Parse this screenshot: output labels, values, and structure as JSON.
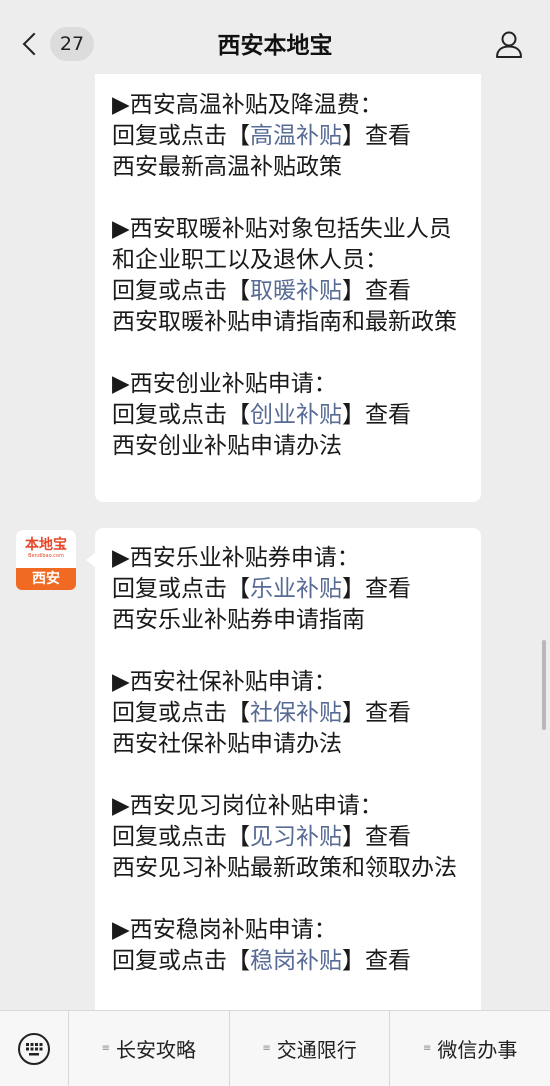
{
  "header": {
    "back_count": "27",
    "title": "西安本地宝"
  },
  "messages": {
    "first": [
      {
        "heading": "▶西安高温补贴及降温费：",
        "prefix": "回复或点击【",
        "link": "高温补贴",
        "suffix": "】查看",
        "desc": "西安最新高温补贴政策"
      },
      {
        "heading": "▶西安取暖补贴对象包括失业人员和企业职工以及退休人员：",
        "prefix": "回复或点击【",
        "link": "取暖补贴",
        "suffix": "】查看",
        "desc": "西安取暖补贴申请指南和最新政策"
      },
      {
        "heading": "▶西安创业补贴申请：",
        "prefix": "回复或点击【",
        "link": "创业补贴",
        "suffix": "】查看",
        "desc": "西安创业补贴申请办法"
      }
    ],
    "second": [
      {
        "heading": "▶西安乐业补贴券申请：",
        "prefix": "回复或点击【",
        "link": "乐业补贴",
        "suffix": "】查看",
        "desc": "西安乐业补贴券申请指南"
      },
      {
        "heading": "▶西安社保补贴申请：",
        "prefix": "回复或点击【",
        "link": "社保补贴",
        "suffix": "】查看",
        "desc": "西安社保补贴申请办法"
      },
      {
        "heading": "▶西安见习岗位补贴申请：",
        "prefix": "回复或点击【",
        "link": "见习补贴",
        "suffix": "】查看",
        "desc": "西安见习补贴最新政策和领取办法"
      },
      {
        "heading": "▶西安稳岗补贴申请：",
        "prefix": "回复或点击【",
        "link": "稳岗补贴",
        "suffix": "】查看",
        "desc": ""
      }
    ]
  },
  "avatar": {
    "brand": "本地宝",
    "url": "Bendibao.com",
    "city": "西安"
  },
  "bottom_menu": {
    "items": [
      "长安攻略",
      "交通限行",
      "微信办事"
    ]
  },
  "icons": {
    "back": "chevron-left-icon",
    "profile": "person-icon",
    "keyboard": "keyboard-icon",
    "menu": "menu-lines-icon"
  },
  "colors": {
    "link": "#576b95",
    "background": "#ededed",
    "avatar_accent": "#f16a24"
  }
}
